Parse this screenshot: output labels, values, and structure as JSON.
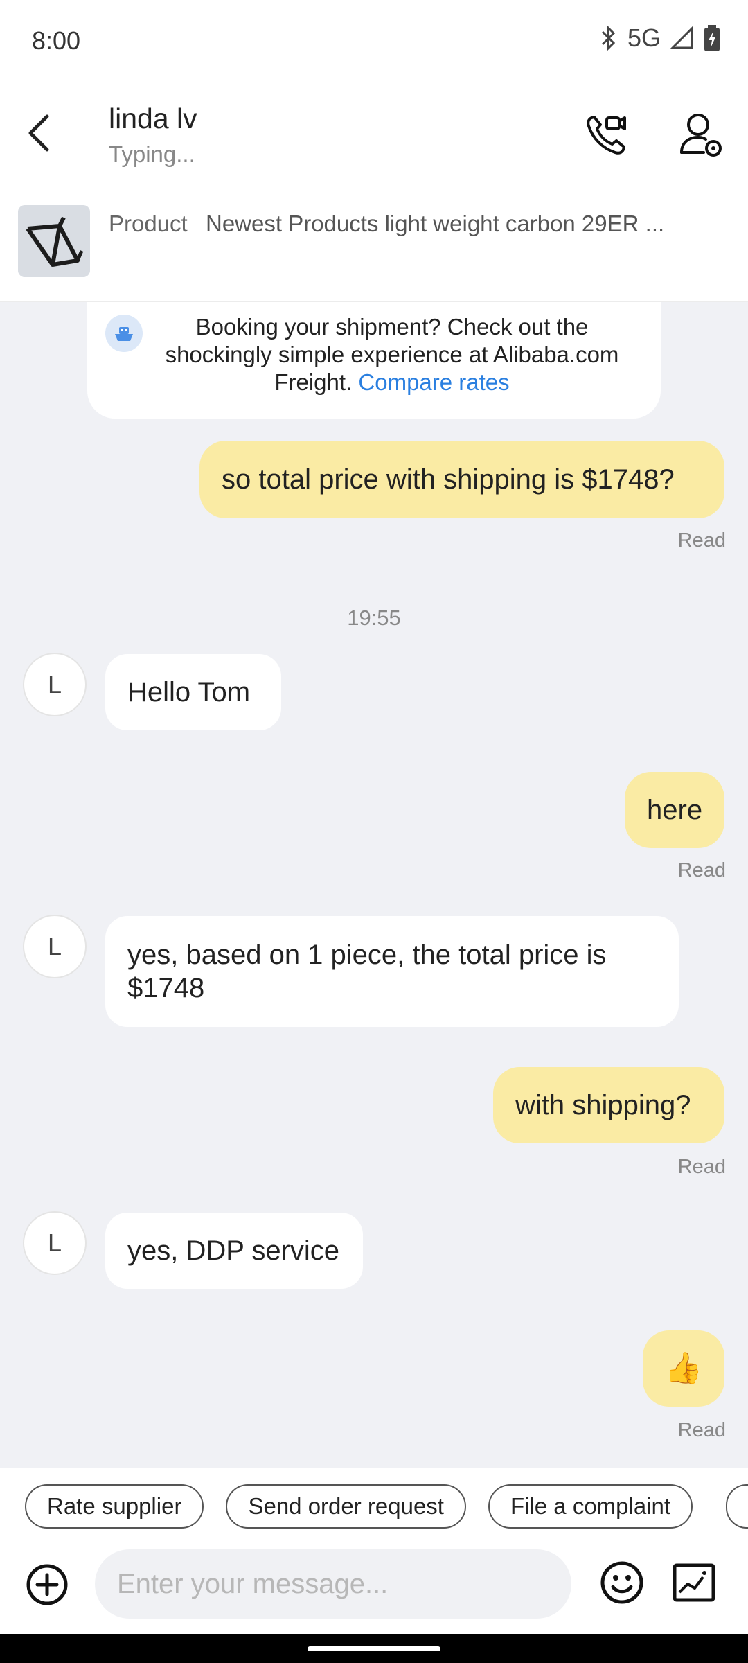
{
  "status_bar": {
    "time": "8:00",
    "network": "5G"
  },
  "header": {
    "name": "linda lv",
    "status": "Typing..."
  },
  "product": {
    "label": "Product",
    "title": "Newest Products light weight carbon 29ER ..."
  },
  "freight": {
    "text": "Booking your shipment? Check out the shockingly simple experience at Alibaba.com Freight.",
    "link": "Compare rates"
  },
  "messages": {
    "m1": {
      "text": "so total price with shipping is $1748?",
      "read": "Read"
    },
    "time": "19:55",
    "m2": {
      "avatar": "L",
      "text": "Hello Tom"
    },
    "m3": {
      "text": "here",
      "read": "Read"
    },
    "m4": {
      "avatar": "L",
      "text": "yes, based on 1 piece, the total price is $1748"
    },
    "m5": {
      "text": "with shipping?",
      "read": "Read"
    },
    "m6": {
      "avatar": "L",
      "text": "yes, DDP service"
    },
    "m7": {
      "text": "👍",
      "read": "Read"
    }
  },
  "quick_actions": [
    "Rate supplier",
    "Send order request",
    "File a complaint"
  ],
  "composer": {
    "placeholder": "Enter your message..."
  },
  "colors": {
    "outgoing_bubble": "#faeba4",
    "link": "#2a7fe0",
    "background": "#f0f1f5"
  }
}
